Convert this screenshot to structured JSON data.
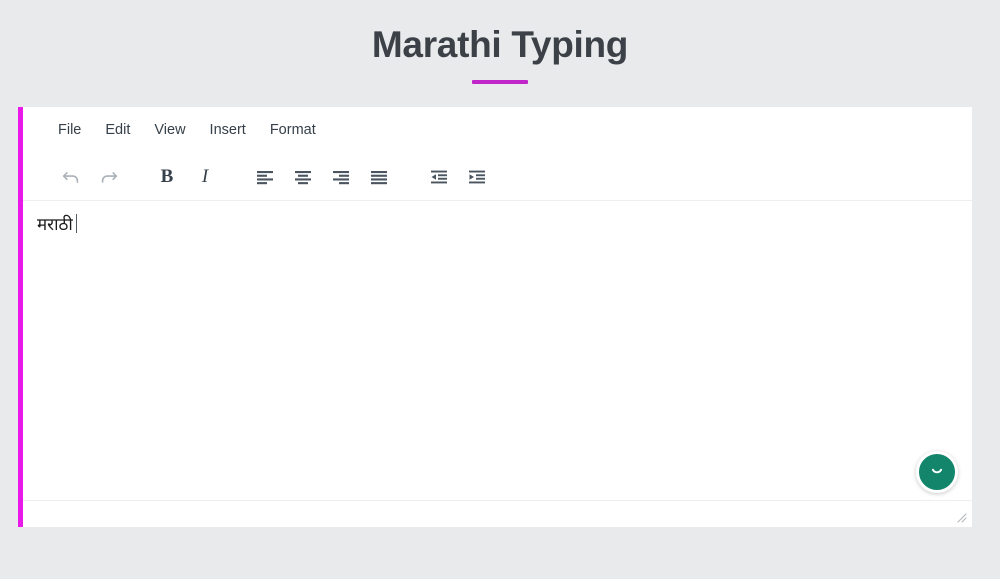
{
  "page": {
    "title": "Marathi Typing",
    "background_color": "#e8eaec",
    "accent_color": "#c026c9"
  },
  "editor": {
    "accent_bar_color": "#e91ae9",
    "menubar": {
      "items": [
        {
          "label": "File",
          "name": "menu-item-file"
        },
        {
          "label": "Edit",
          "name": "menu-item-edit"
        },
        {
          "label": "View",
          "name": "menu-item-view"
        },
        {
          "label": "Insert",
          "name": "menu-item-insert"
        },
        {
          "label": "Format",
          "name": "menu-item-format"
        }
      ]
    },
    "toolbar": {
      "buttons": [
        {
          "icon": "undo-icon",
          "label": "Undo"
        },
        {
          "icon": "redo-icon",
          "label": "Redo"
        },
        {
          "icon": "bold-icon",
          "label": "B"
        },
        {
          "icon": "italic-icon",
          "label": "I"
        },
        {
          "icon": "align-left-icon",
          "label": "Align left"
        },
        {
          "icon": "align-center-icon",
          "label": "Align center"
        },
        {
          "icon": "align-right-icon",
          "label": "Align right"
        },
        {
          "icon": "align-justify-icon",
          "label": "Justify"
        },
        {
          "icon": "outdent-icon",
          "label": "Decrease indent"
        },
        {
          "icon": "indent-icon",
          "label": "Increase indent"
        }
      ],
      "bold_label": "B",
      "italic_label": "I"
    },
    "content": {
      "text": "मराठी",
      "placeholder": "",
      "caret_visible": true
    },
    "statusbar": {
      "text": "",
      "resize_grip": "resize-handle-icon"
    },
    "assistant_badge": {
      "name": "grammar-assistant-icon",
      "color": "#12856b"
    }
  }
}
